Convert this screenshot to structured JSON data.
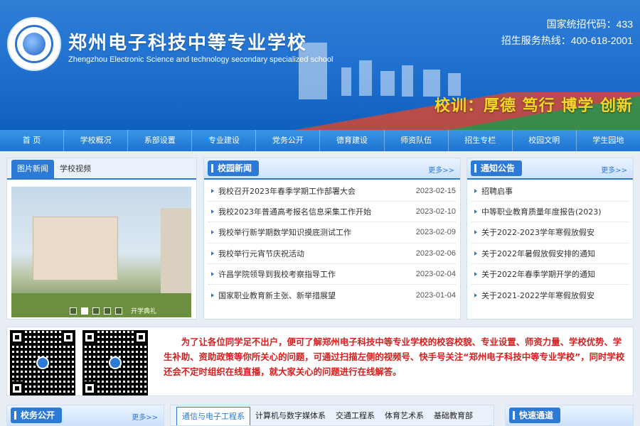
{
  "header": {
    "school_name": "郑州电子科技中等专业学校",
    "school_name_en": "Zhengzhou Electronic Science and technology secondary specialized school",
    "code_text": "国家统招代码：433",
    "hotline_text": "招生服务热线：400-618-2001",
    "motto": "校训：厚德  笃行  博学  创新"
  },
  "nav": [
    "首 页",
    "学校概况",
    "系部设置",
    "专业建设",
    "党务公开",
    "德育建设",
    "师资队伍",
    "招生专栏",
    "校园文明",
    "学生园地"
  ],
  "photo_panel": {
    "tabs": [
      "图片新闻",
      "学校视频"
    ],
    "caption": "开学典礼"
  },
  "campus_news": {
    "title": "校园新闻",
    "more": "更多>>",
    "items": [
      {
        "title": "我校召开2023年春季学期工作部署大会",
        "date": "2023-02-15"
      },
      {
        "title": "我校2023年普通高考报名信息采集工作开始",
        "date": "2023-02-10"
      },
      {
        "title": "我校举行新学期数学知识摸底测试工作",
        "date": "2023-02-09"
      },
      {
        "title": "我校举行元宵节庆祝活动",
        "date": "2023-02-06"
      },
      {
        "title": "许昌学院领导到我校考察指导工作",
        "date": "2023-02-04"
      },
      {
        "title": "国家职业教育新主张、新举措展望",
        "date": "2023-01-04"
      }
    ]
  },
  "notice": {
    "title": "通知公告",
    "more": "更多>>",
    "items": [
      {
        "title": "招聘启事"
      },
      {
        "title": "中等职业教育质量年度报告(2023)"
      },
      {
        "title": "关于2022-2023学年寒假放假安"
      },
      {
        "title": "关于2022年暑假放假安排的通知"
      },
      {
        "title": "关于2022年春季学期开学的通知"
      },
      {
        "title": "关于2021-2022学年寒假放假安"
      }
    ]
  },
  "qr_notice": "为了让各位同学足不出户，便可了解郑州电子科技中等专业学校的校容校貌、专业设置、师资力量、学校优势、学生补助、资助政策等你所关心的问题，可通过扫描左侧的视频号、快手号关注“郑州电子科技中等专业学校”，同时学校还会不定时组织在线直播，就大家关心的问题进行在线解答。",
  "bottom": {
    "affairs_title": "校务公开",
    "affairs_more": "更多>>",
    "dept_tabs": [
      "通信与电子工程系",
      "计算机与数字媒体系",
      "交通工程系",
      "体育艺术系",
      "基础教育部"
    ],
    "quick_title": "快速通道"
  },
  "colors": {
    "primary": "#2d7ad6",
    "motto": "#f5d629",
    "notice_red": "#d42020"
  }
}
